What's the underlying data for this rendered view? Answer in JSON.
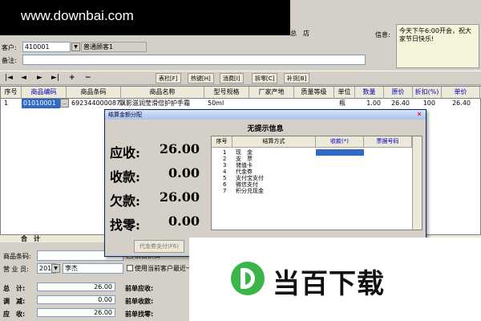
{
  "watermark": {
    "site": "www.downbai.com",
    "logo_text": "当百下载"
  },
  "header": {
    "store_label": "总　店",
    "customer_label": "客户:",
    "customer_code": "410001",
    "customer_name": "普通顾客1",
    "remark_label": "备注:",
    "info_label": "信息:",
    "info_text": "今天下午6:00开会，祝大家节日快乐!"
  },
  "toolbar": {
    "nav": [
      "|◄",
      "◄",
      "►",
      "►|",
      "+",
      "−"
    ],
    "buttons": [
      "表栏[F]",
      "热键[H]",
      "消费[I]",
      "拆零[C]",
      "补货[B]"
    ]
  },
  "grid": {
    "columns": [
      "序号",
      "商品编码",
      "商品条码",
      "商品名称",
      "型号规格",
      "厂家产地",
      "质量等级",
      "单位",
      "数量",
      "原价",
      "折扣(%)",
      "单价"
    ],
    "row": {
      "seq": "1",
      "code": "01010001",
      "barcode": "6923440000871",
      "name": "飘影滋润莹滑倍护护手霜",
      "spec": "50ml",
      "unit": "瓶",
      "qty": "1.00",
      "price": "26.40",
      "discount": "100",
      "unit_price": "26.40"
    },
    "total_label": "合　计"
  },
  "dialog": {
    "title": "结算金额分配",
    "heading": "无提示信息",
    "receivable_label": "应收:",
    "receivable": "26.00",
    "received_label": "收款:",
    "received": "0.00",
    "owed_label": "欠款:",
    "owed": "26.00",
    "change_label": "找零:",
    "change": "0.00",
    "pay_columns": [
      "序号",
      "结算方式",
      "收款(*)",
      "票据号码"
    ],
    "pay_methods": [
      {
        "seq": "1",
        "name": "现　金"
      },
      {
        "seq": "2",
        "name": "支　票"
      },
      {
        "seq": "3",
        "name": "储值卡"
      },
      {
        "seq": "4",
        "name": "代金券"
      },
      {
        "seq": "5",
        "name": "支付宝支付"
      },
      {
        "seq": "6",
        "name": "微信支付"
      },
      {
        "seq": "7",
        "name": "积分兑现金"
      }
    ],
    "voucher_button": "代金券支付(F6)"
  },
  "bottom": {
    "barcode_label": "商品条码:",
    "clerk_label": "营 业 员:",
    "clerk_code": "201",
    "clerk_name": "李杰",
    "option1": "前台折扣",
    "option2": "使用当前客户最近一",
    "total_label": "总　计:",
    "total": "26.00",
    "adjust_label": "调　减:",
    "adjust": "0.00",
    "receivable_label": "应　收:",
    "receivable": "26.00",
    "prev_receivable": "前单应收:",
    "prev_received": "前单收款:",
    "prev_change": "前单找零:"
  }
}
